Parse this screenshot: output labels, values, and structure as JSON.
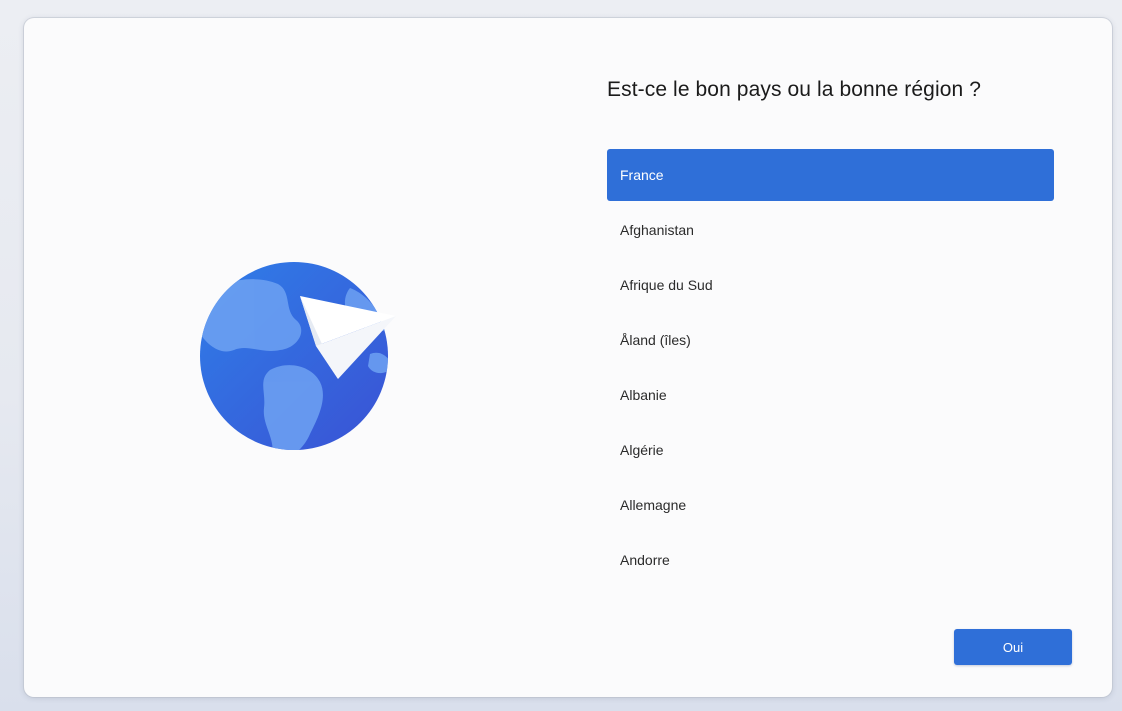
{
  "setup": {
    "title": "Est-ce le bon pays ou la bonne région ?",
    "illustration_icon": "globe-paper-plane-icon",
    "accent_color": "#2f6fd8",
    "regions": [
      {
        "label": "France",
        "selected": true
      },
      {
        "label": "Afghanistan",
        "selected": false
      },
      {
        "label": "Afrique du Sud",
        "selected": false
      },
      {
        "label": "Åland (îles)",
        "selected": false
      },
      {
        "label": "Albanie",
        "selected": false
      },
      {
        "label": "Algérie",
        "selected": false
      },
      {
        "label": "Allemagne",
        "selected": false
      },
      {
        "label": "Andorre",
        "selected": false
      }
    ],
    "confirm_label": "Oui"
  }
}
